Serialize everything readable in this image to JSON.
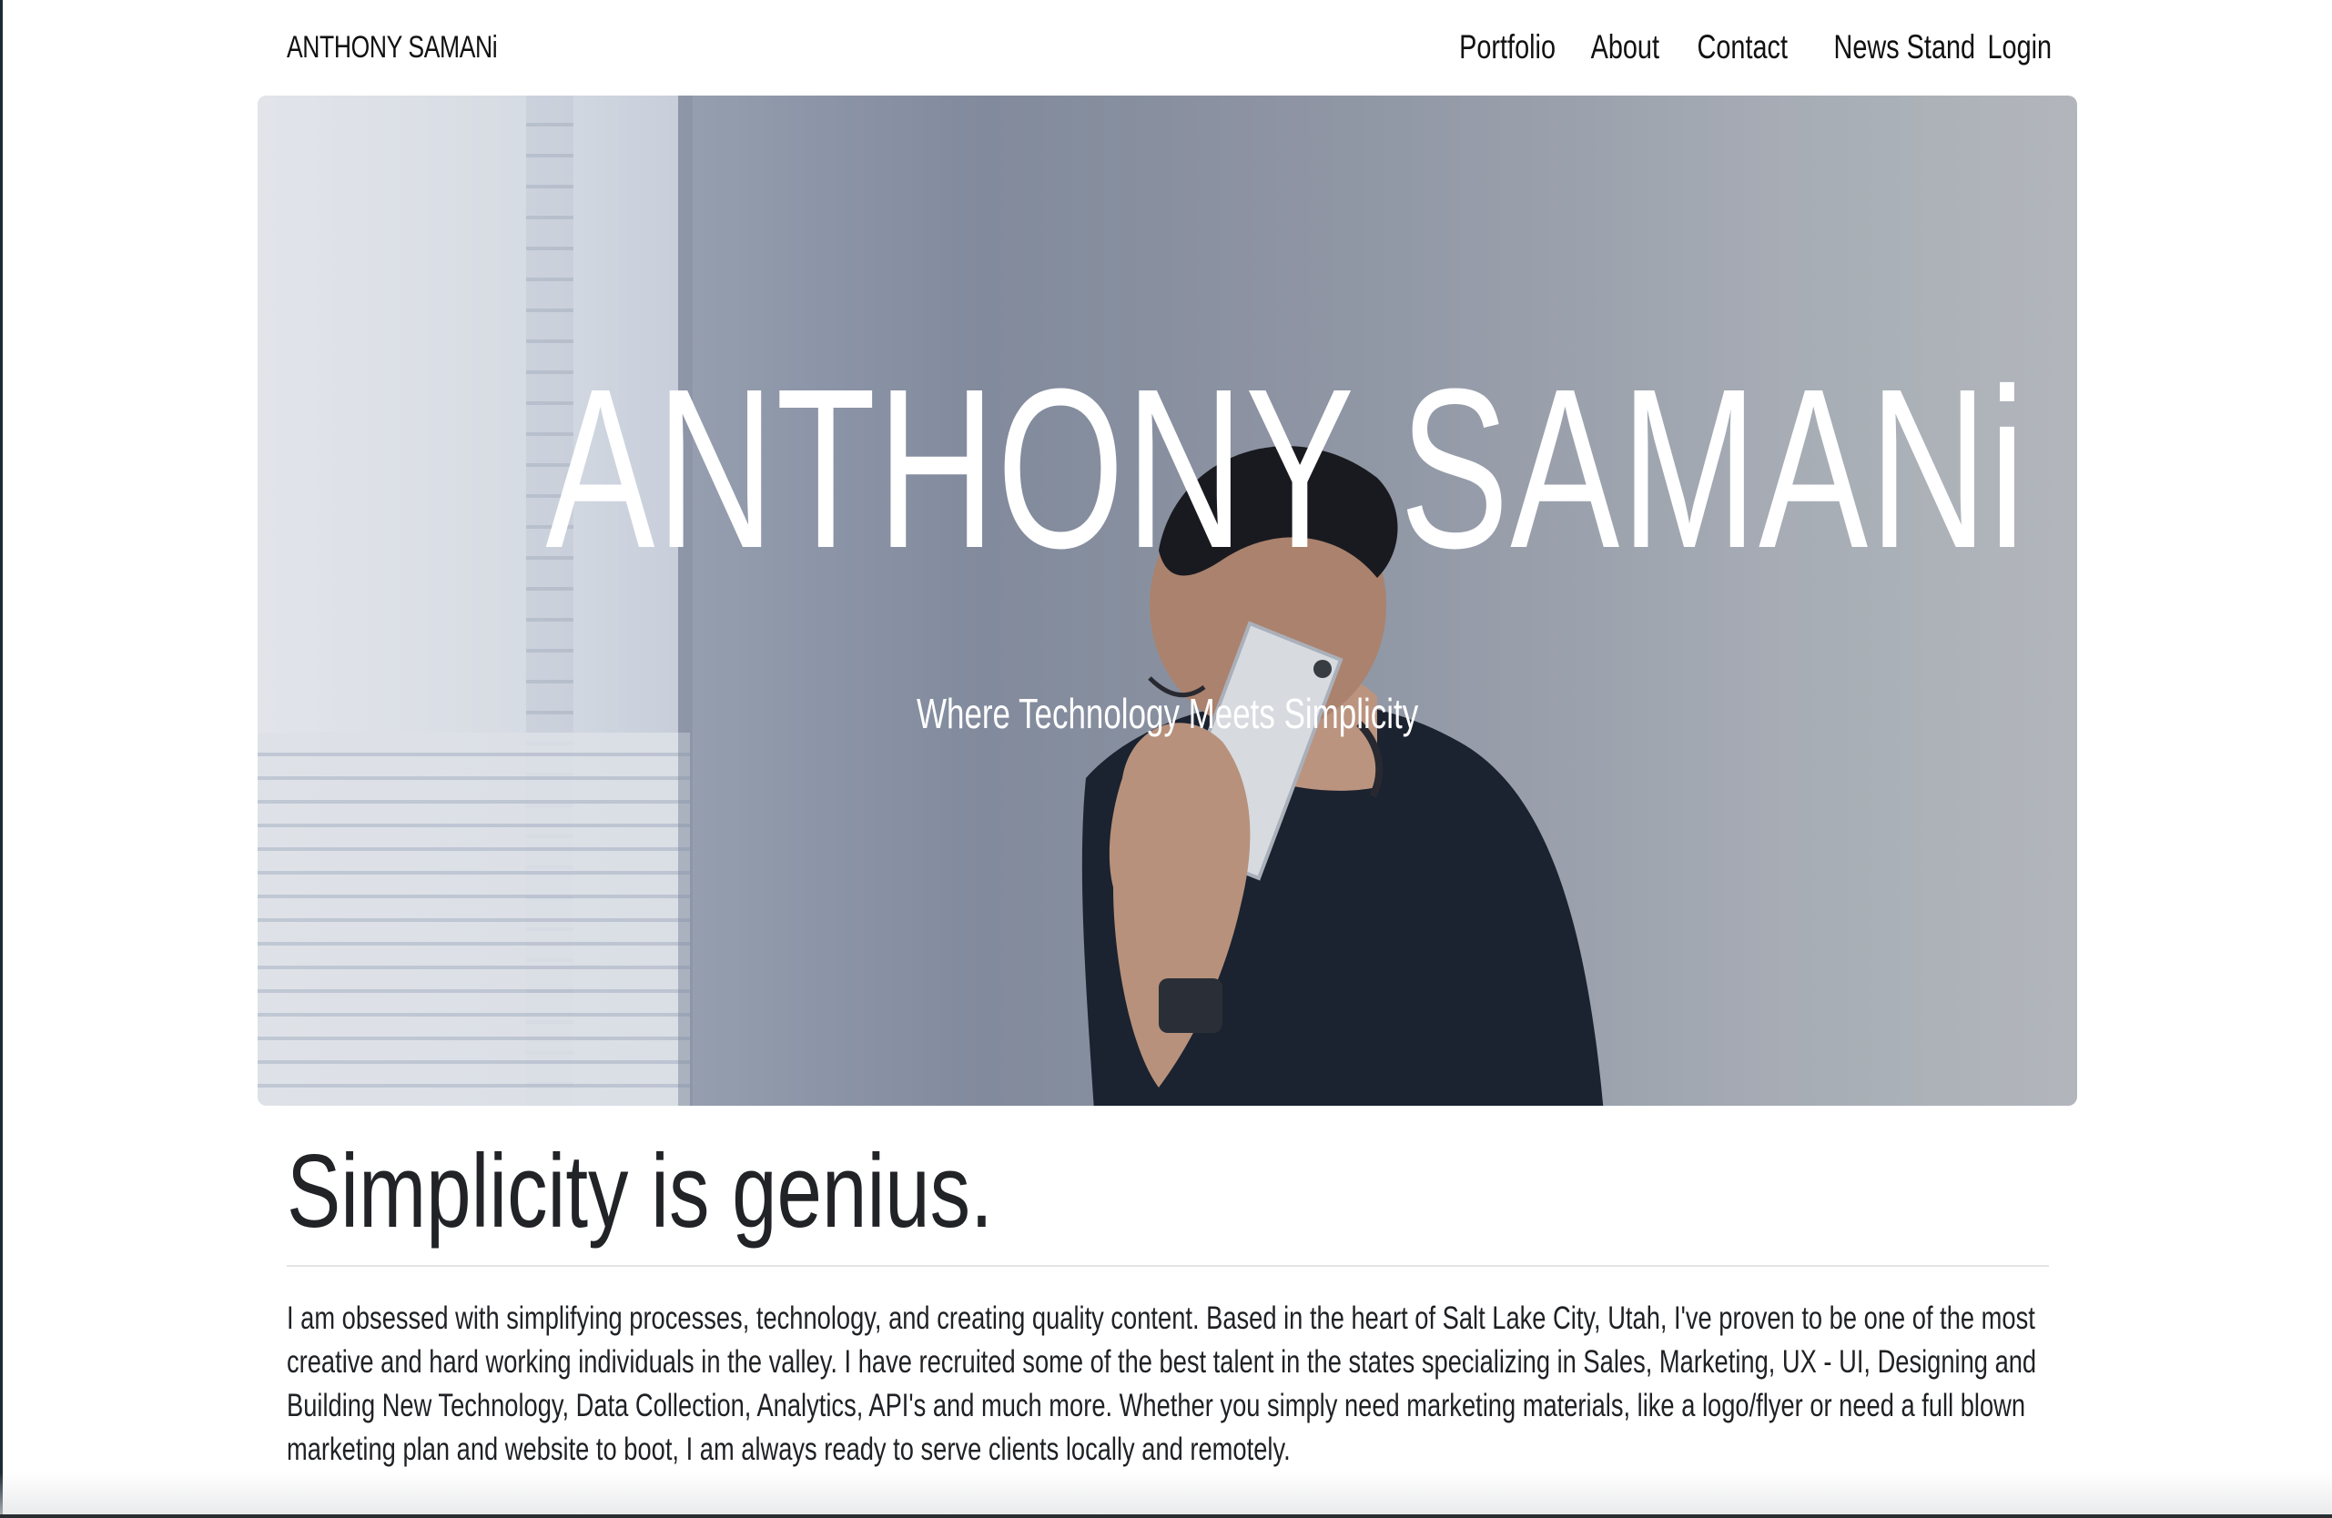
{
  "navbar": {
    "brand": "ANTHONY SAMANi",
    "links": [
      {
        "label": "Portfolio"
      },
      {
        "label": "About"
      },
      {
        "label": "Contact"
      },
      {
        "label": "News Stand"
      },
      {
        "label": "Login"
      }
    ]
  },
  "hero": {
    "title": "ANTHONY SAMANi",
    "subtitle": "Where Technology Meets Simplicity"
  },
  "main": {
    "heading": "Simplicity is genius.",
    "bio": "I am obsessed with simplifying processes, technology, and creating quality content. Based in the heart of Salt Lake City, Utah, I've proven to be one of the most creative and hard working individuals in the valley. I have recruited some of the best talent in the states specializing in Sales, Marketing, UX - UI, Designing and Building New Technology, Data Collection, Analytics, API's and much more. Whether you simply need marketing materials, like a logo/flyer or need a full blown marketing plan and website to boot, I am always ready to serve clients locally and remotely."
  },
  "icons": {
    "hero_image": "man-on-phone-photo"
  }
}
